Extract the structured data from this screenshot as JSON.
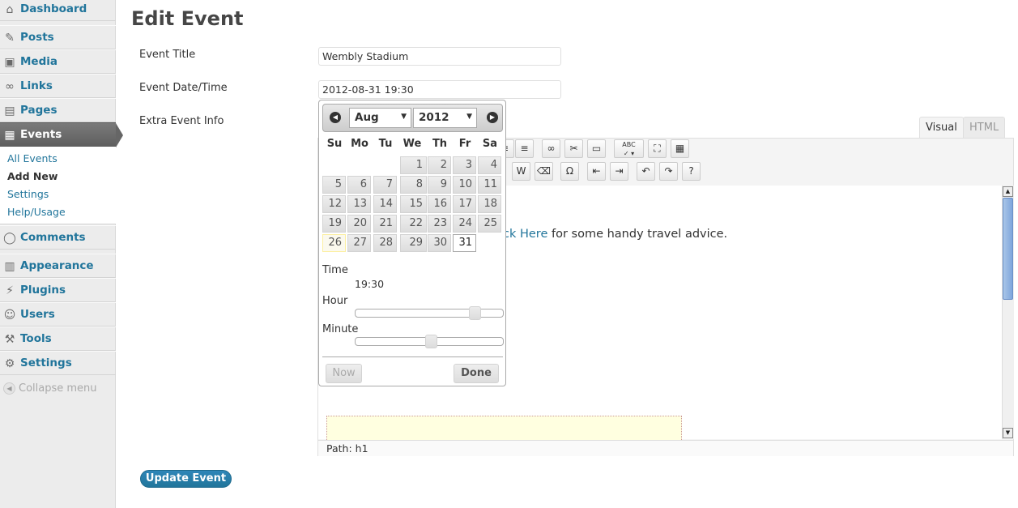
{
  "sidebar": {
    "items": [
      {
        "label": "Dashboard",
        "icon": "dashboard-icon"
      },
      {
        "label": "Posts",
        "icon": "pin-icon"
      },
      {
        "label": "Media",
        "icon": "media-icon"
      },
      {
        "label": "Links",
        "icon": "link-icon"
      },
      {
        "label": "Pages",
        "icon": "pages-icon"
      },
      {
        "label": "Events",
        "icon": "events-icon"
      },
      {
        "label": "Comments",
        "icon": "comments-icon"
      },
      {
        "label": "Appearance",
        "icon": "appearance-icon"
      },
      {
        "label": "Plugins",
        "icon": "plugins-icon"
      },
      {
        "label": "Users",
        "icon": "users-icon"
      },
      {
        "label": "Tools",
        "icon": "tools-icon"
      },
      {
        "label": "Settings",
        "icon": "settings-icon"
      }
    ],
    "submenu": [
      "All Events",
      "Add New",
      "Settings",
      "Help/Usage"
    ],
    "collapse_label": "Collapse menu"
  },
  "page": {
    "title": "Edit Event",
    "fields": {
      "title_label": "Event Title",
      "title_value": "Wembly Stadium",
      "datetime_label": "Event Date/Time",
      "datetime_value": "2012-08-31 19:30",
      "extra_label": "Extra Event Info"
    }
  },
  "editor": {
    "tab_visual": "Visual",
    "tab_html": "HTML",
    "content_link": "ck Here",
    "content_text": " for some handy travel advice.",
    "path_label": "Path:",
    "path_value": "h1"
  },
  "datepicker": {
    "month": "Aug",
    "year": "2012",
    "weekdays": [
      "Su",
      "Mo",
      "Tu",
      "We",
      "Th",
      "Fr",
      "Sa"
    ],
    "weeks": [
      [
        "",
        "",
        "",
        "1",
        "2",
        "3",
        "4"
      ],
      [
        "5",
        "6",
        "7",
        "8",
        "9",
        "10",
        "11"
      ],
      [
        "12",
        "13",
        "14",
        "15",
        "16",
        "17",
        "18"
      ],
      [
        "19",
        "20",
        "21",
        "22",
        "23",
        "24",
        "25"
      ],
      [
        "26",
        "27",
        "28",
        "29",
        "30",
        "31",
        ""
      ]
    ],
    "highlight_day": "26",
    "selected_day": "31",
    "time_label": "Time",
    "time_value": "19:30",
    "hour_label": "Hour",
    "hour_value": 19,
    "minute_label": "Minute",
    "minute_value": 30,
    "now_label": "Now",
    "done_label": "Done"
  },
  "update_button": "Update Event",
  "colors": {
    "link": "#21759b",
    "active_menu": "#5f5f5f",
    "highlight": "#ffffe0"
  }
}
